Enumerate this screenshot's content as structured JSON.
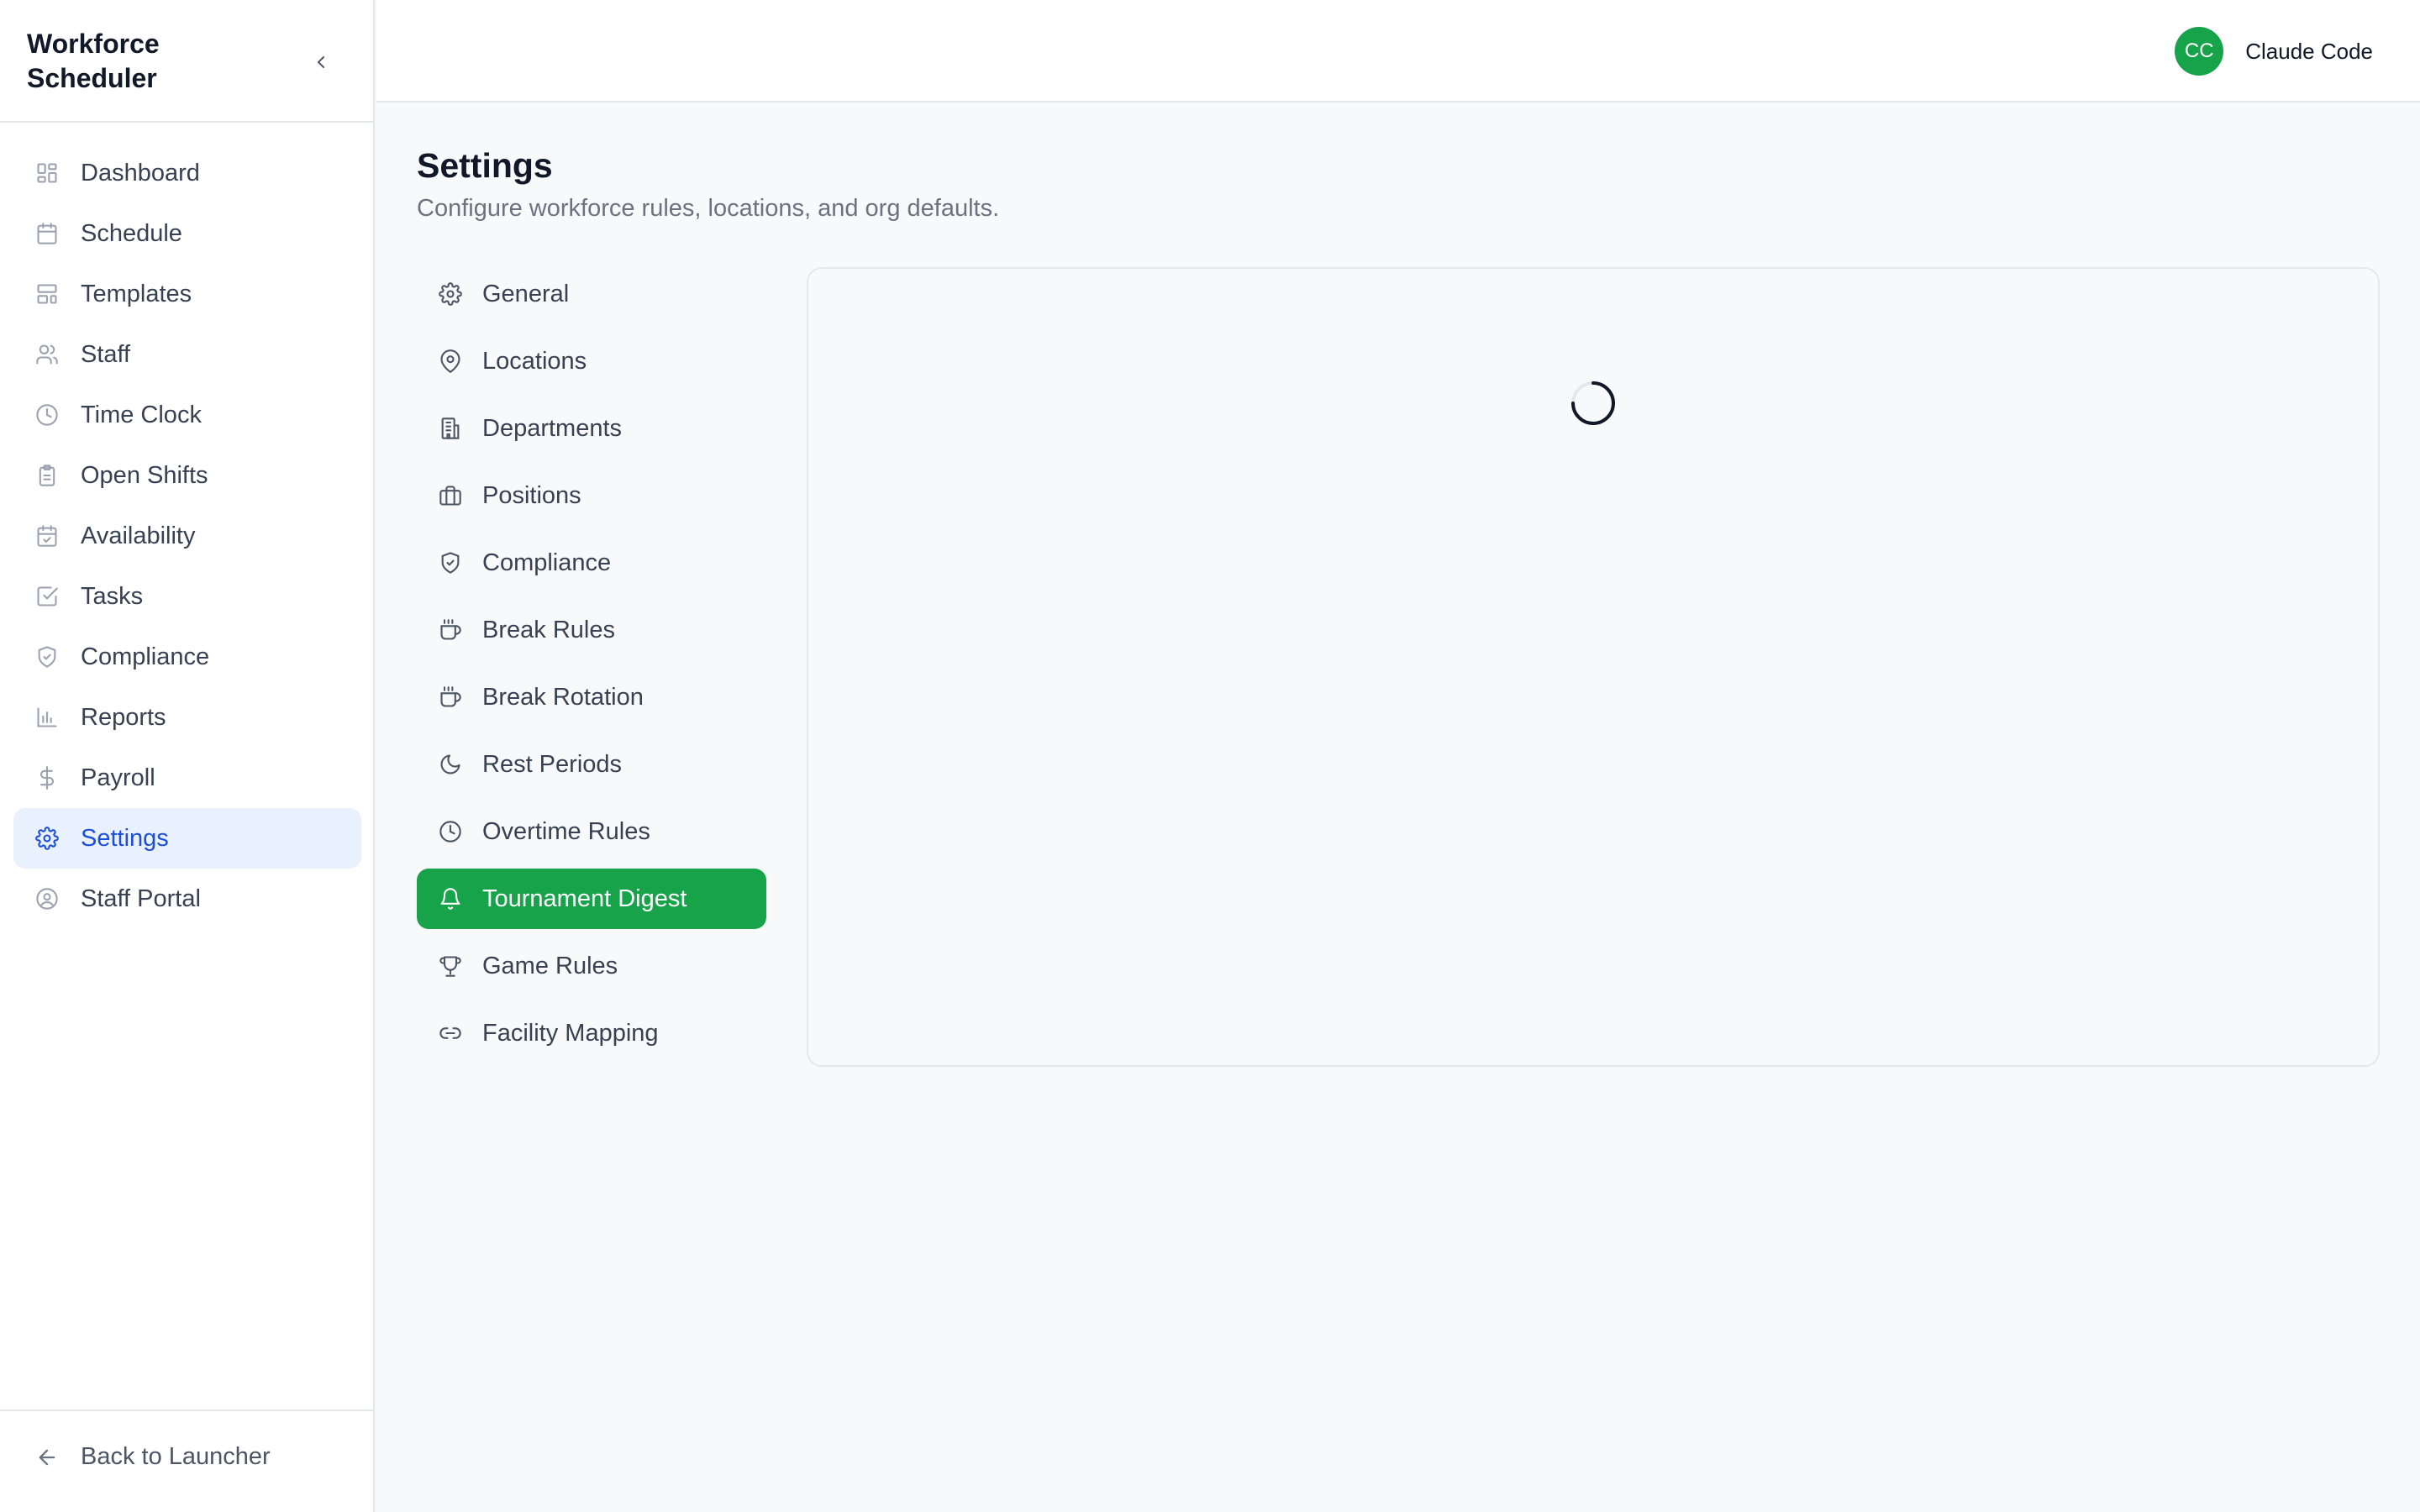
{
  "app": {
    "title": "Workforce Scheduler"
  },
  "sidebar": {
    "items": [
      {
        "label": "Dashboard",
        "icon": "dashboard-icon"
      },
      {
        "label": "Schedule",
        "icon": "calendar-icon"
      },
      {
        "label": "Templates",
        "icon": "templates-icon"
      },
      {
        "label": "Staff",
        "icon": "users-icon"
      },
      {
        "label": "Time Clock",
        "icon": "clock-icon"
      },
      {
        "label": "Open Shifts",
        "icon": "clipboard-icon"
      },
      {
        "label": "Availability",
        "icon": "calendar-check-icon"
      },
      {
        "label": "Tasks",
        "icon": "checkbox-icon"
      },
      {
        "label": "Compliance",
        "icon": "shield-check-icon"
      },
      {
        "label": "Reports",
        "icon": "bar-chart-icon"
      },
      {
        "label": "Payroll",
        "icon": "dollar-icon"
      },
      {
        "label": "Settings",
        "icon": "gear-icon",
        "active": true
      },
      {
        "label": "Staff Portal",
        "icon": "user-circle-icon"
      }
    ],
    "footer": {
      "back_label": "Back to Launcher"
    }
  },
  "topbar": {
    "user": {
      "initials": "CC",
      "name": "Claude Code",
      "avatar_color": "#16a34a"
    }
  },
  "main": {
    "title": "Settings",
    "subtitle": "Configure workforce rules, locations, and org defaults.",
    "settings_nav": [
      {
        "label": "General",
        "icon": "gear-icon"
      },
      {
        "label": "Locations",
        "icon": "map-pin-icon"
      },
      {
        "label": "Departments",
        "icon": "building-icon"
      },
      {
        "label": "Positions",
        "icon": "briefcase-icon"
      },
      {
        "label": "Compliance",
        "icon": "shield-check-icon"
      },
      {
        "label": "Break Rules",
        "icon": "coffee-icon"
      },
      {
        "label": "Break Rotation",
        "icon": "coffee-icon"
      },
      {
        "label": "Rest Periods",
        "icon": "moon-icon"
      },
      {
        "label": "Overtime Rules",
        "icon": "clock-icon"
      },
      {
        "label": "Tournament Digest",
        "icon": "bell-icon",
        "active": true
      },
      {
        "label": "Game Rules",
        "icon": "trophy-icon"
      },
      {
        "label": "Facility Mapping",
        "icon": "link-icon"
      }
    ],
    "content_state": "loading"
  },
  "colors": {
    "accent_green": "#16a34a",
    "active_nav_bg": "#e8f1fd",
    "active_nav_text": "#1d4ed8"
  }
}
